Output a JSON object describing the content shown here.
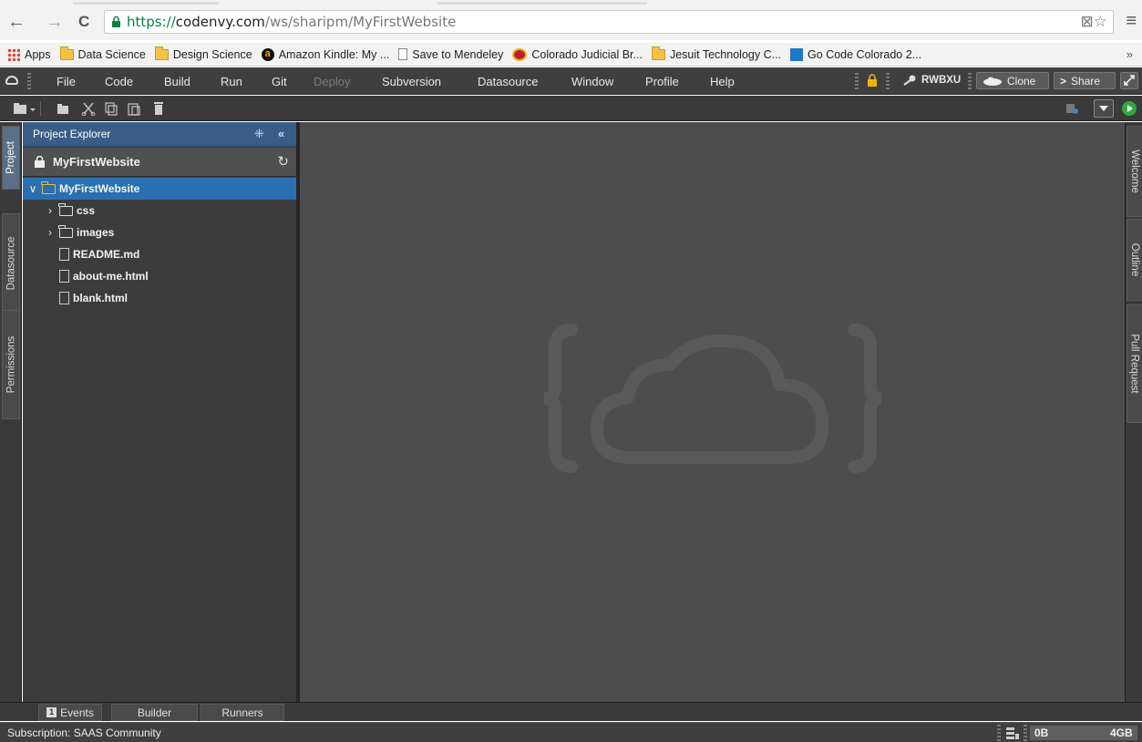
{
  "browser": {
    "back": "←",
    "forward": "→",
    "reload": "C",
    "url_scheme": "https://",
    "url_host": "codenvy.com",
    "url_path": "/ws/sharipm/MyFirstWebsite",
    "right_icons": "⊠☆",
    "menu": "≡"
  },
  "bookmarks": {
    "items": [
      {
        "label": "Apps",
        "icon": "apps-icon"
      },
      {
        "label": "Data Science",
        "icon": "folder-icon"
      },
      {
        "label": "Design Science",
        "icon": "folder-icon"
      },
      {
        "label": "Amazon Kindle: My ...",
        "icon": "amazon-icon"
      },
      {
        "label": "Save to Mendeley",
        "icon": "page-icon"
      },
      {
        "label": "Colorado Judicial Br...",
        "icon": "colorado-icon"
      },
      {
        "label": "Jesuit Technology C...",
        "icon": "folder-icon"
      },
      {
        "label": "Go Code Colorado 2...",
        "icon": "gocode-icon"
      }
    ],
    "more": "»"
  },
  "ide_menu": {
    "items": [
      {
        "label": "File",
        "enabled": true
      },
      {
        "label": "Code",
        "enabled": true
      },
      {
        "label": "Build",
        "enabled": true
      },
      {
        "label": "Run",
        "enabled": true
      },
      {
        "label": "Git",
        "enabled": true
      },
      {
        "label": "Deploy",
        "enabled": false
      },
      {
        "label": "Subversion",
        "enabled": true
      },
      {
        "label": "Datasource",
        "enabled": true
      },
      {
        "label": "Window",
        "enabled": true
      },
      {
        "label": "Profile",
        "enabled": true
      },
      {
        "label": "Help",
        "enabled": true
      }
    ],
    "access_mode": "RWBXU",
    "clone_label": "Clone",
    "share_label": "Share"
  },
  "left_tabs": [
    "Project",
    "Datasource",
    "Permissions"
  ],
  "explorer": {
    "title": "Project Explorer",
    "project_name": "MyFirstWebsite",
    "tree": [
      {
        "label": "MyFirstWebsite",
        "type": "folder-open",
        "depth": 0,
        "chevron": "∨",
        "selected": true
      },
      {
        "label": "css",
        "type": "folder",
        "depth": 1,
        "chevron": "›",
        "selected": false
      },
      {
        "label": "images",
        "type": "folder",
        "depth": 1,
        "chevron": "›",
        "selected": false
      },
      {
        "label": "README.md",
        "type": "file",
        "depth": 1,
        "chevron": "",
        "selected": false
      },
      {
        "label": "about-me.html",
        "type": "file",
        "depth": 1,
        "chevron": "",
        "selected": false
      },
      {
        "label": "blank.html",
        "type": "file",
        "depth": 1,
        "chevron": "",
        "selected": false
      }
    ]
  },
  "right_tabs": [
    "Welcome",
    "Outline",
    "Pull Request"
  ],
  "bottom_tabs": [
    {
      "label": "Events",
      "badge": "1"
    },
    {
      "label": "Builder",
      "badge": ""
    },
    {
      "label": "Runners",
      "badge": ""
    }
  ],
  "status": {
    "subscription": "Subscription: SAAS Community",
    "mem_used": "0B",
    "mem_total": "4GB",
    "mem_fraction": 0
  },
  "colors": {
    "editor_bg": "#4d4d4d",
    "explorer_header": "#3a5d88",
    "selection": "#2a70b0",
    "run_green": "#2eab3f"
  }
}
